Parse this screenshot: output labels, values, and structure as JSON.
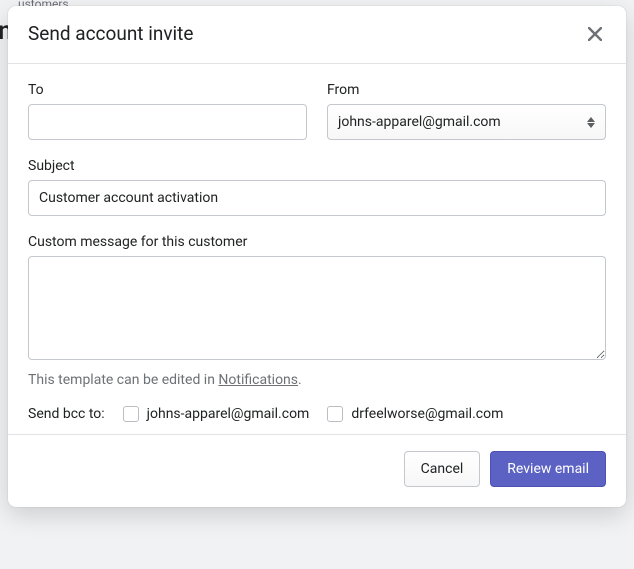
{
  "modal": {
    "title": "Send account invite",
    "to": {
      "label": "To",
      "value": ""
    },
    "from": {
      "label": "From",
      "selected": "johns-apparel@gmail.com"
    },
    "subject": {
      "label": "Subject",
      "value": "Customer account activation"
    },
    "custom_message": {
      "label": "Custom message for this customer",
      "value": ""
    },
    "template_hint_prefix": "This template can be edited in ",
    "template_hint_link": "Notifications",
    "template_hint_suffix": ".",
    "bcc": {
      "label": "Send bcc to:",
      "options": [
        {
          "email": "johns-apparel@gmail.com",
          "checked": false
        },
        {
          "email": "drfeelworse@gmail.com",
          "checked": false
        }
      ]
    },
    "buttons": {
      "cancel": "Cancel",
      "review": "Review email"
    }
  }
}
